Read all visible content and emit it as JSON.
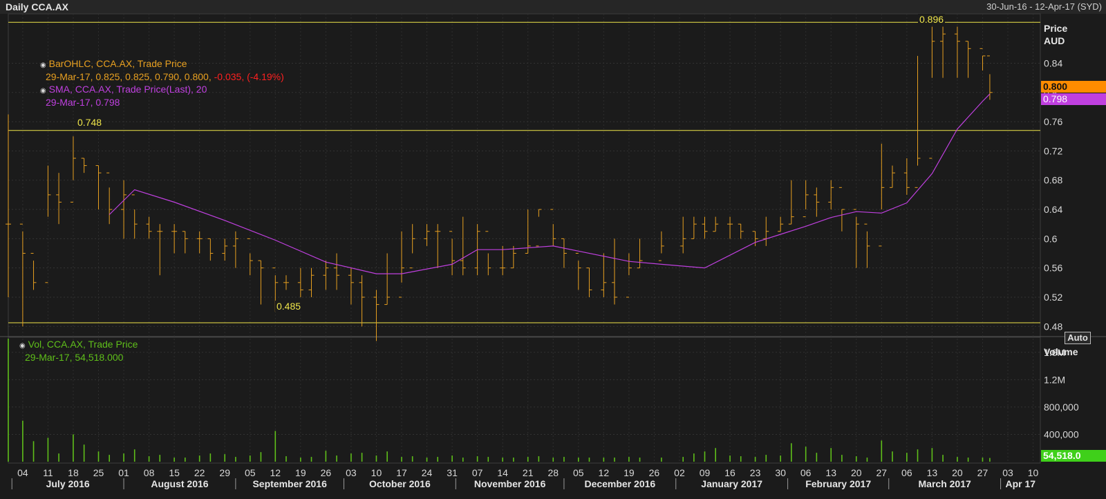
{
  "window": {
    "title": "Daily CCA.AX",
    "date_range": "30-Jun-16 - 12-Apr-17 (SYD)"
  },
  "legend": {
    "ohlc_title": "BarOHLC, CCA.AX, Trade Price",
    "ohlc_values": "29-Mar-17, 0.825, 0.825, 0.790, 0.800,",
    "ohlc_change": "-0.035, (-4.19%)",
    "sma_title": "SMA, CCA.AX, Trade Price(Last),  20",
    "sma_value": "29-Mar-17, 0.798",
    "vol_title": "Vol, CCA.AX, Trade Price",
    "vol_value": "29-Mar-17, 54,518.000"
  },
  "price_axis": {
    "label1": "Price",
    "label2": "AUD",
    "ticks": [
      "0.84",
      "0.8",
      "0.76",
      "0.72",
      "0.68",
      "0.64",
      "0.6",
      "0.56",
      "0.52",
      "0.48"
    ],
    "last_price_tag": "0.800",
    "sma_tag": "0.798",
    "auto_button": "Auto"
  },
  "volume_axis": {
    "label": "Volume",
    "ticks": [
      "1.6M",
      "1.2M",
      "800,000",
      "400,000"
    ],
    "last_volume_tag": "54,518.0"
  },
  "x_axis": {
    "day_ticks": [
      "04",
      "11",
      "18",
      "25",
      "01",
      "08",
      "15",
      "22",
      "29",
      "05",
      "12",
      "19",
      "26",
      "03",
      "10",
      "17",
      "24",
      "31",
      "07",
      "14",
      "21",
      "28",
      "05",
      "12",
      "19",
      "26",
      "02",
      "09",
      "16",
      "23",
      "30",
      "06",
      "13",
      "20",
      "27",
      "06",
      "13",
      "20",
      "27",
      "03",
      "10"
    ],
    "months": [
      "July 2016",
      "August 2016",
      "September 2016",
      "October 2016",
      "November 2016",
      "December 2016",
      "January 2017",
      "February 2017",
      "March 2017",
      "Apr 17"
    ]
  },
  "levels": {
    "high": "0.896",
    "mid": "0.748",
    "low": "0.485"
  },
  "colors": {
    "ohlc": "#e8a020",
    "sma": "#c040e0",
    "volume": "#5fbf1a",
    "level": "#f0e64a",
    "down": "#ff2020",
    "price_tag": "#ff8c00",
    "sma_tag": "#c040e0",
    "vol_tag": "#3fd01a"
  },
  "chart_data": [
    {
      "type": "line",
      "title": "Daily CCA.AX",
      "ylabel": "Price AUD",
      "ylim": [
        0.468,
        0.9
      ],
      "xlim": [
        "2016-06-30",
        "2017-04-12"
      ],
      "series": [
        {
          "name": "BarOHLC, CCA.AX, Trade Price",
          "x": [
            "2016-06-30",
            "2016-07-04",
            "2016-07-07",
            "2016-07-11",
            "2016-07-14",
            "2016-07-18",
            "2016-07-21",
            "2016-07-25",
            "2016-07-28",
            "2016-08-01",
            "2016-08-04",
            "2016-08-08",
            "2016-08-11",
            "2016-08-15",
            "2016-08-18",
            "2016-08-22",
            "2016-08-25",
            "2016-08-29",
            "2016-09-01",
            "2016-09-05",
            "2016-09-08",
            "2016-09-12",
            "2016-09-15",
            "2016-09-19",
            "2016-09-22",
            "2016-09-26",
            "2016-09-29",
            "2016-10-03",
            "2016-10-06",
            "2016-10-10",
            "2016-10-13",
            "2016-10-17",
            "2016-10-20",
            "2016-10-24",
            "2016-10-27",
            "2016-10-31",
            "2016-11-03",
            "2016-11-07",
            "2016-11-10",
            "2016-11-14",
            "2016-11-17",
            "2016-11-21",
            "2016-11-24",
            "2016-11-28",
            "2016-12-01",
            "2016-12-05",
            "2016-12-08",
            "2016-12-12",
            "2016-12-15",
            "2016-12-19",
            "2016-12-22",
            "2016-12-28",
            "2017-01-03",
            "2017-01-06",
            "2017-01-09",
            "2017-01-12",
            "2017-01-16",
            "2017-01-19",
            "2017-01-23",
            "2017-01-26",
            "2017-01-30",
            "2017-02-02",
            "2017-02-06",
            "2017-02-09",
            "2017-02-13",
            "2017-02-16",
            "2017-02-20",
            "2017-02-23",
            "2017-02-27",
            "2017-03-02",
            "2017-03-06",
            "2017-03-09",
            "2017-03-13",
            "2017-03-16",
            "2017-03-20",
            "2017-03-23",
            "2017-03-27",
            "2017-03-29"
          ],
          "close": [
            0.62,
            0.58,
            0.54,
            0.66,
            0.65,
            0.71,
            0.7,
            0.69,
            0.64,
            0.66,
            0.62,
            0.61,
            0.61,
            0.61,
            0.6,
            0.6,
            0.58,
            0.59,
            0.6,
            0.57,
            0.56,
            0.54,
            0.54,
            0.53,
            0.55,
            0.56,
            0.55,
            0.54,
            0.52,
            0.51,
            0.52,
            0.56,
            0.6,
            0.61,
            0.61,
            0.57,
            0.56,
            0.61,
            0.56,
            0.56,
            0.58,
            0.59,
            0.64,
            0.6,
            0.58,
            0.56,
            0.53,
            0.54,
            0.52,
            0.56,
            0.57,
            0.59,
            0.6,
            0.62,
            0.61,
            0.62,
            0.62,
            0.61,
            0.6,
            0.61,
            0.62,
            0.63,
            0.66,
            0.65,
            0.67,
            0.64,
            0.62,
            0.59,
            0.67,
            0.69,
            0.67,
            0.71,
            0.87,
            0.88,
            0.87,
            0.86,
            0.85,
            0.8
          ],
          "high": [
            0.77,
            0.61,
            0.57,
            0.7,
            0.69,
            0.74,
            0.71,
            0.7,
            0.67,
            0.68,
            0.64,
            0.63,
            0.62,
            0.62,
            0.61,
            0.61,
            0.6,
            0.6,
            0.61,
            0.58,
            0.57,
            0.55,
            0.55,
            0.56,
            0.56,
            0.57,
            0.58,
            0.56,
            0.55,
            0.53,
            0.58,
            0.61,
            0.62,
            0.62,
            0.62,
            0.6,
            0.63,
            0.62,
            0.58,
            0.59,
            0.59,
            0.64,
            0.64,
            0.62,
            0.6,
            0.57,
            0.56,
            0.58,
            0.6,
            0.58,
            0.6,
            0.61,
            0.63,
            0.63,
            0.63,
            0.63,
            0.63,
            0.62,
            0.61,
            0.63,
            0.63,
            0.68,
            0.68,
            0.67,
            0.68,
            0.64,
            0.63,
            0.61,
            0.73,
            0.7,
            0.71,
            0.85,
            0.89,
            0.89,
            0.89,
            0.87,
            0.85,
            0.825
          ],
          "low": [
            0.52,
            0.48,
            0.53,
            0.63,
            0.62,
            0.68,
            0.69,
            0.64,
            0.62,
            0.6,
            0.6,
            0.6,
            0.55,
            0.58,
            0.58,
            0.58,
            0.57,
            0.57,
            0.56,
            0.55,
            0.51,
            0.5,
            0.53,
            0.52,
            0.52,
            0.53,
            0.53,
            0.51,
            0.48,
            0.46,
            0.51,
            0.54,
            0.58,
            0.59,
            0.56,
            0.55,
            0.55,
            0.55,
            0.55,
            0.55,
            0.56,
            0.58,
            0.63,
            0.59,
            0.56,
            0.53,
            0.52,
            0.52,
            0.51,
            0.55,
            0.56,
            0.58,
            0.58,
            0.6,
            0.6,
            0.61,
            0.6,
            0.6,
            0.59,
            0.59,
            0.61,
            0.62,
            0.64,
            0.63,
            0.64,
            0.61,
            0.56,
            0.56,
            0.64,
            0.67,
            0.66,
            0.7,
            0.82,
            0.82,
            0.82,
            0.82,
            0.83,
            0.79
          ]
        },
        {
          "name": "SMA, CCA.AX, Trade Price(Last),  20",
          "x": [
            "2016-07-28",
            "2016-08-04",
            "2016-08-15",
            "2016-08-29",
            "2016-09-12",
            "2016-09-26",
            "2016-10-10",
            "2016-10-17",
            "2016-10-31",
            "2016-11-07",
            "2016-11-14",
            "2016-11-28",
            "2016-12-05",
            "2016-12-19",
            "2016-12-28",
            "2017-01-09",
            "2017-01-23",
            "2017-02-06",
            "2017-02-13",
            "2017-02-20",
            "2017-02-27",
            "2017-03-06",
            "2017-03-13",
            "2017-03-20",
            "2017-03-27",
            "2017-03-29"
          ],
          "values": [
            0.633,
            0.667,
            0.65,
            0.625,
            0.598,
            0.568,
            0.552,
            0.552,
            0.565,
            0.585,
            0.585,
            0.59,
            0.583,
            0.569,
            0.565,
            0.56,
            0.595,
            0.617,
            0.629,
            0.637,
            0.635,
            0.649,
            0.689,
            0.75,
            0.788,
            0.798
          ]
        }
      ],
      "annotations": [
        {
          "label": "0.896",
          "y": 0.896
        },
        {
          "label": "0.748",
          "y": 0.748
        },
        {
          "label": "0.485",
          "y": 0.485
        }
      ],
      "last_values": {
        "price": "0.800",
        "sma": "0.798"
      },
      "grid": true,
      "legend": "top-left"
    },
    {
      "type": "bar",
      "title": "Vol, CCA.AX, Trade Price",
      "ylabel": "Volume",
      "ylim": [
        0,
        1800000
      ],
      "x": [
        "2016-06-30",
        "2016-07-04",
        "2016-07-07",
        "2016-07-11",
        "2016-07-14",
        "2016-07-18",
        "2016-07-21",
        "2016-07-25",
        "2016-07-28",
        "2016-08-01",
        "2016-08-04",
        "2016-08-08",
        "2016-08-11",
        "2016-08-15",
        "2016-08-18",
        "2016-08-22",
        "2016-08-25",
        "2016-08-29",
        "2016-09-01",
        "2016-09-05",
        "2016-09-08",
        "2016-09-12",
        "2016-09-15",
        "2016-09-19",
        "2016-09-22",
        "2016-09-26",
        "2016-09-29",
        "2016-10-03",
        "2016-10-06",
        "2016-10-10",
        "2016-10-13",
        "2016-10-17",
        "2016-10-20",
        "2016-10-24",
        "2016-10-27",
        "2016-10-31",
        "2016-11-03",
        "2016-11-07",
        "2016-11-10",
        "2016-11-14",
        "2016-11-17",
        "2016-11-21",
        "2016-11-24",
        "2016-11-28",
        "2016-12-01",
        "2016-12-05",
        "2016-12-08",
        "2016-12-12",
        "2016-12-15",
        "2016-12-19",
        "2016-12-22",
        "2016-12-28",
        "2017-01-03",
        "2017-01-06",
        "2017-01-09",
        "2017-01-12",
        "2017-01-16",
        "2017-01-19",
        "2017-01-23",
        "2017-01-26",
        "2017-01-30",
        "2017-02-02",
        "2017-02-06",
        "2017-02-09",
        "2017-02-13",
        "2017-02-16",
        "2017-02-20",
        "2017-02-23",
        "2017-02-27",
        "2017-03-02",
        "2017-03-06",
        "2017-03-09",
        "2017-03-13",
        "2017-03-16",
        "2017-03-20",
        "2017-03-23",
        "2017-03-27",
        "2017-03-29"
      ],
      "values": [
        1800000,
        600000,
        300000,
        350000,
        120000,
        400000,
        250000,
        150000,
        100000,
        120000,
        180000,
        80000,
        100000,
        60000,
        60000,
        90000,
        120000,
        110000,
        70000,
        90000,
        140000,
        450000,
        80000,
        60000,
        70000,
        160000,
        90000,
        120000,
        130000,
        90000,
        150000,
        70000,
        80000,
        60000,
        70000,
        90000,
        60000,
        80000,
        70000,
        60000,
        60000,
        70000,
        80000,
        60000,
        70000,
        60000,
        60000,
        60000,
        60000,
        70000,
        60000,
        60000,
        70000,
        120000,
        150000,
        200000,
        90000,
        80000,
        70000,
        100000,
        90000,
        270000,
        220000,
        130000,
        200000,
        100000,
        80000,
        60000,
        310000,
        150000,
        130000,
        180000,
        200000,
        100000,
        70000,
        60000,
        60000,
        54518
      ]
    }
  ]
}
